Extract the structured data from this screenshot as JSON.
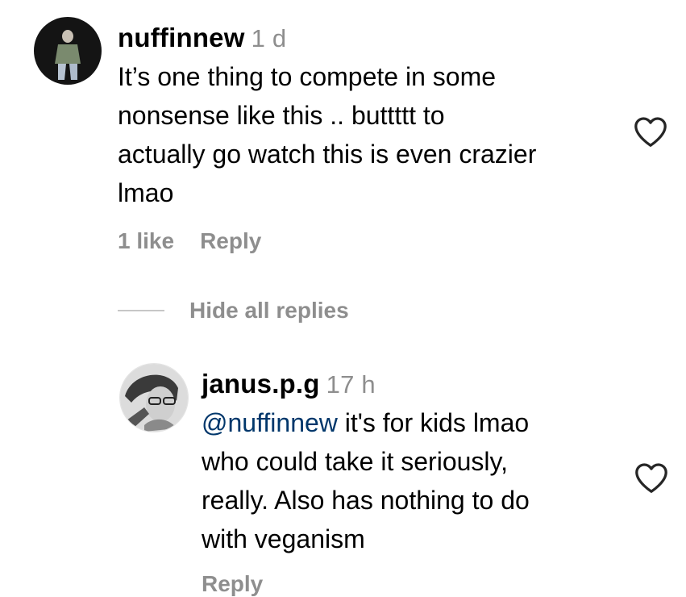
{
  "comments": [
    {
      "username": "nuffinnew",
      "time": "1 d",
      "lines": [
        "It’s one thing to compete in some",
        "nonsense like this .. buttttt to",
        "actually go watch this is even crazier",
        "lmao"
      ],
      "likes": "1 like",
      "reply_label": "Reply"
    }
  ],
  "hide_replies_label": "Hide all replies",
  "replies": [
    {
      "username": "janus.p.g",
      "time": "17 h",
      "mention": "@nuffinnew",
      "first_line_rest": " it's for kids lmao",
      "lines": [
        "who could take it seriously,",
        "really. Also has nothing to do",
        "with veganism"
      ],
      "reply_label": "Reply"
    }
  ],
  "icons": {
    "like": "heart-outline-icon"
  },
  "colors": {
    "secondary_text": "#8e8e8e",
    "mention": "#00376b",
    "divider": "#c7c7c7"
  }
}
